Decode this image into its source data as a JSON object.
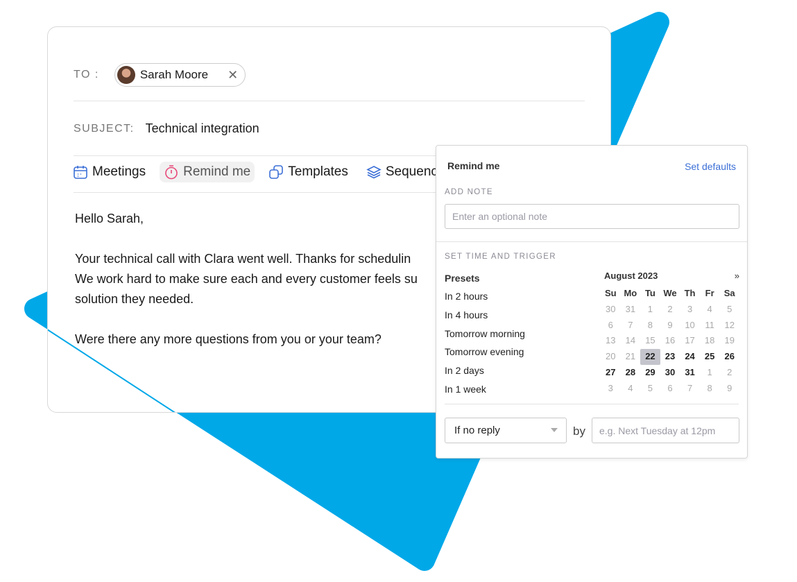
{
  "colors": {
    "accent_blue": "#00a8e8",
    "link": "#3b6fd6",
    "remind_icon": "#e8497a"
  },
  "email": {
    "to_label": "TO :",
    "recipient": "Sarah Moore",
    "subject_label": "SUBJECT:",
    "subject": "Technical integration",
    "toolbar": [
      {
        "label": "Meetings",
        "icon": "calendar-icon"
      },
      {
        "label": "Remind me",
        "icon": "stopwatch-icon"
      },
      {
        "label": "Templates",
        "icon": "copy-icon"
      },
      {
        "label": "Sequences",
        "icon": "layers-icon"
      }
    ],
    "body": [
      "Hello Sarah,",
      "",
      "Your technical call with Clara went well. Thanks for schedulin",
      "We work hard to make sure each and every customer feels su",
      "solution they needed.",
      "",
      "Were there any more questions from you or your team?"
    ]
  },
  "remind": {
    "title": "Remind me",
    "set_defaults": "Set defaults",
    "add_note_label": "ADD NOTE",
    "note_placeholder": "Enter an optional note",
    "trigger_label": "SET TIME AND TRIGGER",
    "presets_title": "Presets",
    "presets": [
      "In 2 hours",
      "In 4 hours",
      "Tomorrow morning",
      "Tomorrow evening",
      "In 2 days",
      "In 1 week"
    ],
    "calendar": {
      "month": "August 2023",
      "next": "»",
      "weekdays": [
        "Su",
        "Mo",
        "Tu",
        "We",
        "Th",
        "Fr",
        "Sa"
      ],
      "days": [
        "30",
        "31",
        "1",
        "2",
        "3",
        "4",
        "5",
        "6",
        "7",
        "8",
        "9",
        "10",
        "11",
        "12",
        "13",
        "14",
        "15",
        "16",
        "17",
        "18",
        "19",
        "20",
        "21",
        "22",
        "23",
        "24",
        "25",
        "26",
        "27",
        "28",
        "29",
        "30",
        "31",
        "1",
        "2",
        "3",
        "4",
        "5",
        "6",
        "7",
        "8",
        "9"
      ],
      "selected": "22"
    },
    "condition": "If no reply",
    "by": "by",
    "date_placeholder": "e.g. Next Tuesday at 12pm"
  }
}
